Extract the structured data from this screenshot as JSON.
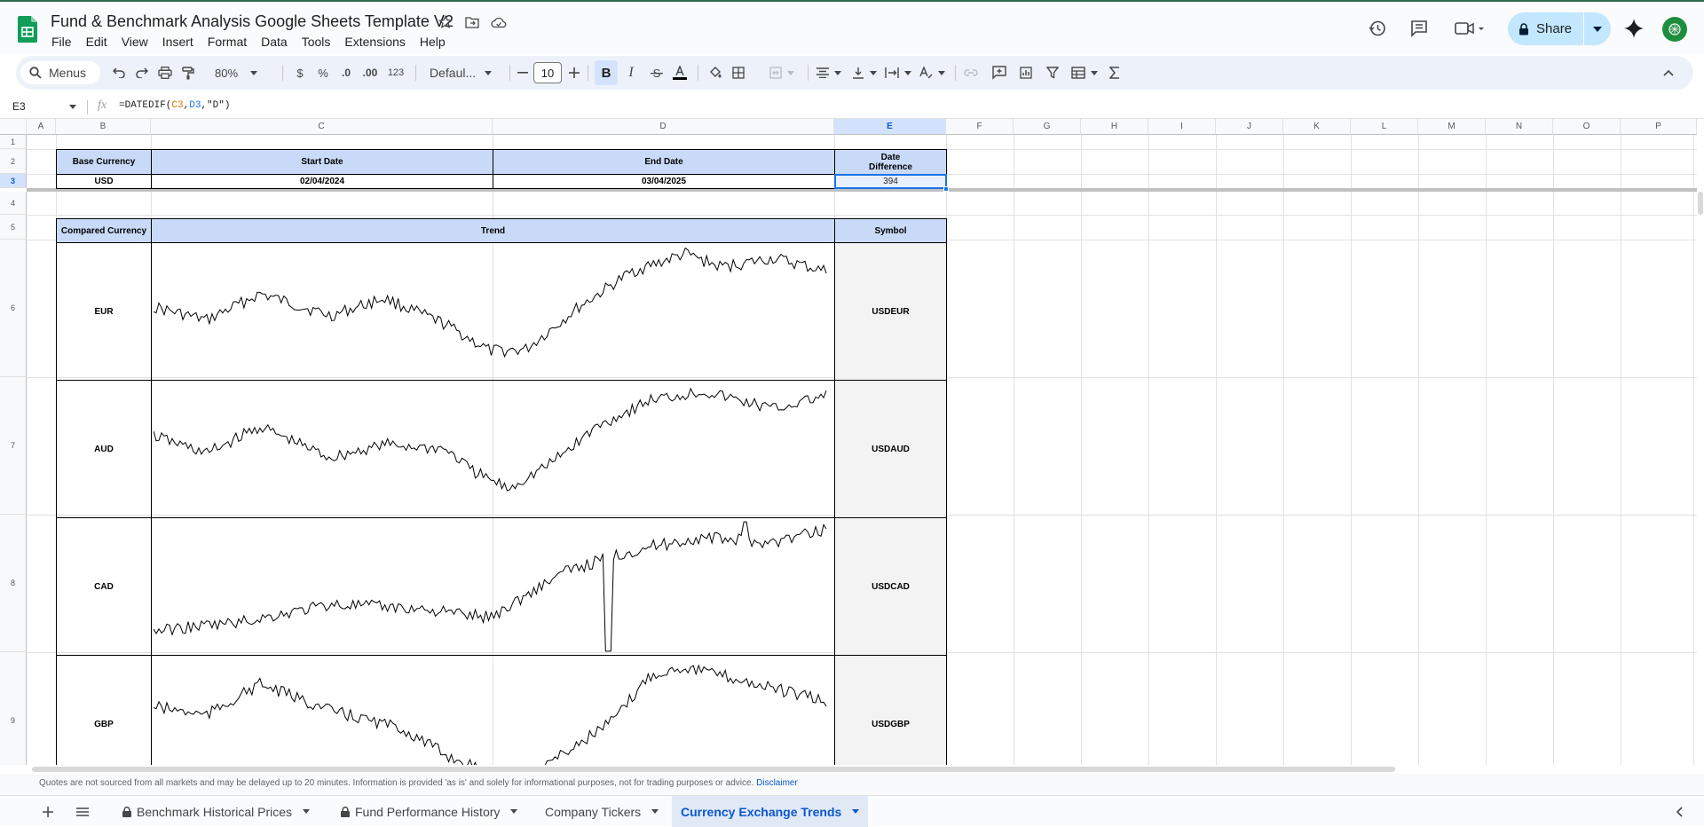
{
  "doc": {
    "title": "Fund & Benchmark Analysis Google Sheets Template V2"
  },
  "menu": [
    "File",
    "Edit",
    "View",
    "Insert",
    "Format",
    "Data",
    "Tools",
    "Extensions",
    "Help"
  ],
  "share": {
    "label": "Share"
  },
  "toolbar": {
    "menus_label": "Menus",
    "zoom": "80%",
    "currency": "$",
    "percent": "%",
    "dec_less": ".0",
    "dec_more": ".00",
    "number_format": "123",
    "font": "Defaul...",
    "font_size": "10",
    "bold": "B",
    "italic": "I"
  },
  "formula_bar": {
    "cell_ref": "E3",
    "fx": "fx",
    "formula_prefix": "=DATEDIF(",
    "arg1": "C3",
    "comma1": ",",
    "arg2": "D3",
    "rest": ",\"D\")"
  },
  "columns": [
    "A",
    "B",
    "C",
    "D",
    "E",
    "F",
    "G",
    "H",
    "I",
    "J",
    "K",
    "L",
    "M",
    "N",
    "O",
    "P"
  ],
  "rows": [
    "1",
    "2",
    "3",
    "4",
    "5",
    "6",
    "7",
    "8",
    "9"
  ],
  "table1": {
    "headers": [
      "Base Currency",
      "Start Date",
      "End Date",
      "Date Difference"
    ],
    "values": [
      "USD",
      "02/04/2024",
      "03/04/2025",
      "394"
    ]
  },
  "table2": {
    "headers": [
      "Compared Currency",
      "Trend",
      "Symbol"
    ],
    "rows": [
      {
        "currency": "EUR",
        "symbol": "USDEUR"
      },
      {
        "currency": "AUD",
        "symbol": "USDAUD"
      },
      {
        "currency": "CAD",
        "symbol": "USDCAD"
      },
      {
        "currency": "GBP",
        "symbol": "USDGBP"
      }
    ]
  },
  "disclaimer": {
    "text": "Quotes are not sourced from all markets and may be delayed up to 20 minutes. Information is provided 'as is' and solely for informational purposes, not for trading purposes or advice.",
    "link": "Disclaimer"
  },
  "sheet_tabs": [
    "Benchmark Historical Prices",
    "Fund Performance History",
    "Company Tickers",
    "Currency Exchange Trends"
  ],
  "colors": {
    "accent": "#0b57d0",
    "header_fill": "#c9daf8",
    "symbol_fill": "#f3f3f3",
    "share_bg": "#c2e7ff"
  }
}
